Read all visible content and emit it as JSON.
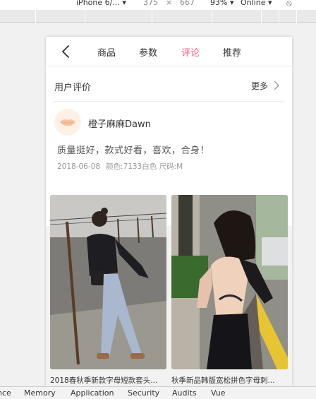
{
  "devtools": {
    "device": "iPhone 6/... ▾",
    "width": "375",
    "times": "×",
    "height": "667",
    "zoom": "93% ▾",
    "network": "Online ▾",
    "tabs": [
      "nce",
      "Memory",
      "Application",
      "Security",
      "Audits",
      "Vue"
    ]
  },
  "nav": {
    "tabs": [
      {
        "label": "商品",
        "active": false
      },
      {
        "label": "参数",
        "active": false
      },
      {
        "label": "评论",
        "active": true
      },
      {
        "label": "推荐",
        "active": false
      }
    ]
  },
  "review": {
    "title": "用户评价",
    "more": "更多",
    "username": "橙子麻麻Dawn",
    "text": "质量挺好，款式好看，喜欢，合身！",
    "date": "2018-06-08",
    "spec": "颜色:7133白色 尺码:M"
  },
  "products": [
    {
      "caption": "2018春秋季新款字母短款套头..."
    },
    {
      "caption": "秋季新品韩版宽松拼色字母刺..."
    }
  ],
  "colors": {
    "accent": "#ff5c86",
    "text": "#333333",
    "muted": "#999999"
  }
}
